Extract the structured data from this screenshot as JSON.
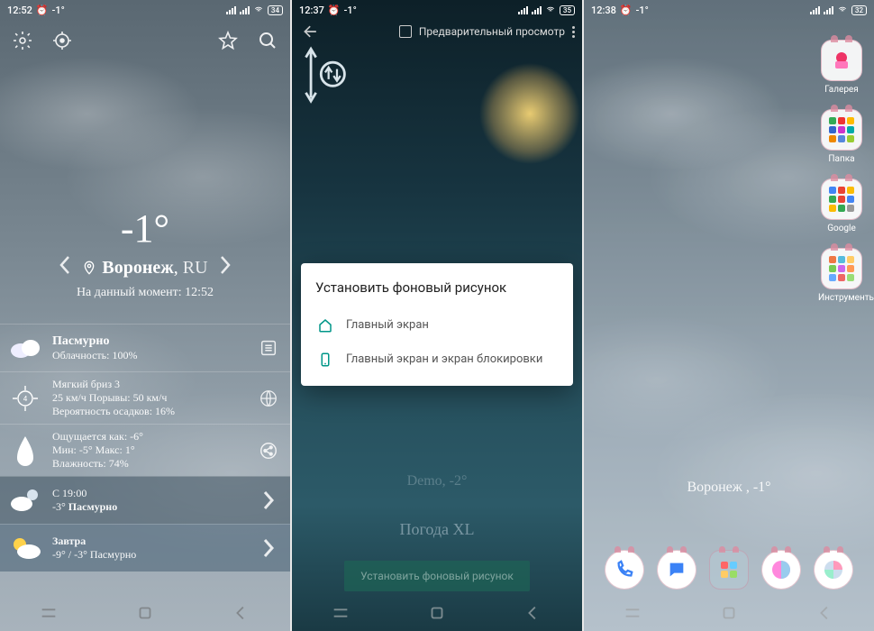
{
  "s1": {
    "status": {
      "time": "12:52",
      "temp": "-1°",
      "battery": "34"
    },
    "main": {
      "temp": "-1°",
      "city": "Воронеж",
      "country": "RU",
      "asof_prefix": "На данный момент:",
      "asof_time": "12:52"
    },
    "rows": {
      "r1": {
        "title": "Пасмурно",
        "sub": "Облачность: 100%"
      },
      "r2": {
        "l1": "Мягкий бриз 3",
        "l2": "25 км/ч Порывы: 50 км/ч",
        "l3": "Вероятность осадков: 16%"
      },
      "r3": {
        "l1": "Ощущается как: -6°",
        "l2": "Мин: -5° Макс: 1°",
        "l3": "Влажность: 74%"
      },
      "r4": {
        "l1": "С 19:00",
        "l2a": "-3°",
        "l2b": "Пасмурно"
      },
      "r5": {
        "l1": "Завтра",
        "l2": "-9° / -3° Пасмурно"
      }
    }
  },
  "s2": {
    "status": {
      "time": "12:37",
      "temp": "-1°",
      "battery": "35"
    },
    "header": {
      "preview": "Предварительный просмотр"
    },
    "dialog": {
      "title": "Установить фоновый рисунок",
      "opt1": "Главный экран",
      "opt2": "Главный экран и экран блокировки"
    },
    "demo": "Demo, -2°",
    "appname": "Погода XL",
    "setbtn": "Установить фоновый рисунок"
  },
  "s3": {
    "status": {
      "time": "12:38",
      "temp": "-1°",
      "battery": "32"
    },
    "apps": {
      "a1": "Галерея",
      "a2": "Папка",
      "a3": "Google",
      "a4": "Инструменты"
    },
    "widget": "Воронеж ,  -1°"
  }
}
